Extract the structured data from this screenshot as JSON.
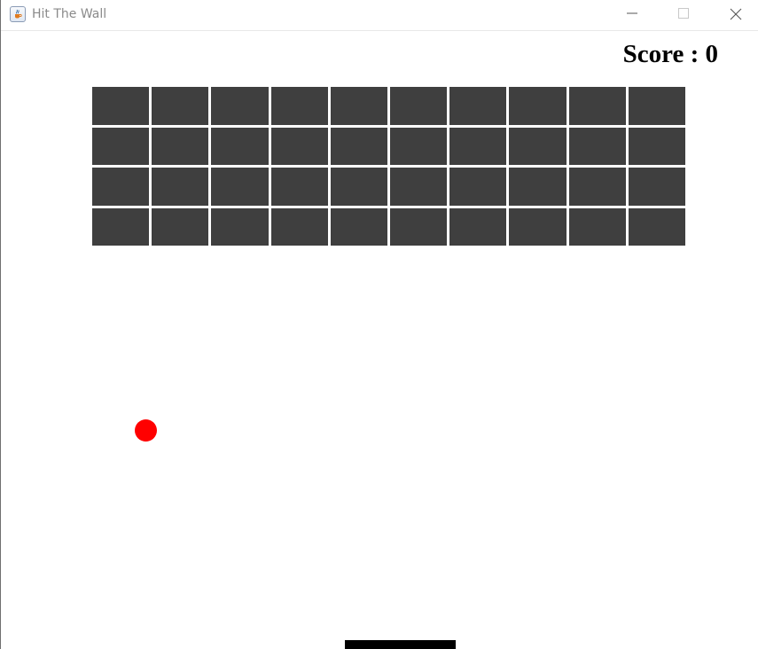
{
  "window": {
    "title": "Hit The Wall",
    "icon": "java-coffee-cup-icon",
    "controls": [
      "minimize-icon",
      "maximize-icon",
      "close-icon"
    ]
  },
  "game": {
    "score_label": "Score : 0",
    "score": 0,
    "bricks": {
      "rows": 4,
      "cols": 10,
      "color": "#3f3f3f",
      "gap_color": "#ffffff"
    },
    "ball": {
      "color": "#ff0000"
    },
    "paddle": {
      "color": "#000000"
    },
    "background": "#ffffff"
  }
}
